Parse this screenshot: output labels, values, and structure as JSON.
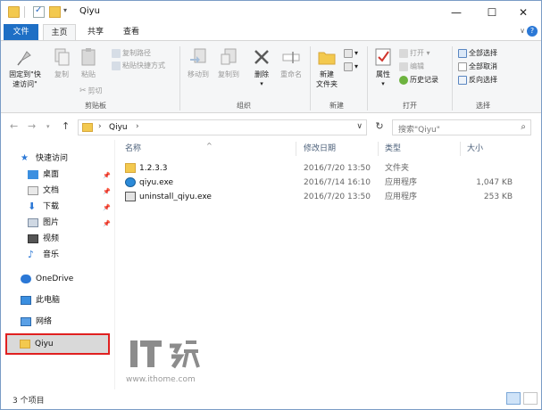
{
  "window": {
    "title": "Qiyu",
    "controls": {
      "minimize": "—",
      "maximize": "☐",
      "close": "✕"
    }
  },
  "ribbon_tabs": {
    "file": "文件",
    "home": "主页",
    "share": "共享",
    "view": "查看",
    "expand": "∨"
  },
  "ribbon": {
    "clipboard": {
      "label": "剪贴板",
      "pin": "固定到\"快\n速访问\"",
      "copy": "复制",
      "paste": "粘贴",
      "copy_path": "复制路径",
      "paste_shortcut": "粘贴快捷方式",
      "cut": "剪切"
    },
    "organize": {
      "label": "组织",
      "move_to": "移动到",
      "copy_to": "复制到",
      "delete": "删除",
      "rename": "重命名"
    },
    "new": {
      "label": "新建",
      "new_folder": "新建\n文件夹"
    },
    "open": {
      "label": "打开",
      "properties": "属性",
      "open": "打开",
      "edit": "编辑",
      "history": "历史记录"
    },
    "select": {
      "label": "选择",
      "select_all": "全部选择",
      "select_none": "全部取消",
      "invert": "反向选择"
    }
  },
  "address_bar": {
    "path": "Qiyu",
    "search_placeholder": "搜索\"Qiyu\""
  },
  "nav_pane": {
    "quick_access": "快速访问",
    "desktop": "桌面",
    "documents": "文档",
    "downloads": "下载",
    "pictures": "图片",
    "videos": "视频",
    "music": "音乐",
    "onedrive": "OneDrive",
    "this_pc": "此电脑",
    "network": "网络",
    "qiyu": "Qiyu"
  },
  "file_list": {
    "columns": {
      "name": "名称",
      "modified": "修改日期",
      "type": "类型",
      "size": "大小"
    },
    "rows": [
      {
        "name": "1.2.3.3",
        "modified": "2016/7/20 13:50",
        "type": "文件夹",
        "size": "",
        "icon": "folder-icon"
      },
      {
        "name": "qiyu.exe",
        "modified": "2016/7/14 16:10",
        "type": "应用程序",
        "size": "1,047 KB",
        "icon": "qiyu-app-icon"
      },
      {
        "name": "uninstall_qiyu.exe",
        "modified": "2016/7/20 13:50",
        "type": "应用程序",
        "size": "253 KB",
        "icon": "uninstall-app-icon"
      }
    ]
  },
  "watermark": {
    "logo_text": "IT之家",
    "url": "www.ithome.com"
  },
  "status_bar": {
    "item_count": "3 个项目"
  },
  "colors": {
    "file_tab": "#1e6fc5",
    "folder": "#f3c94f",
    "highlight_border": "#e02020"
  }
}
